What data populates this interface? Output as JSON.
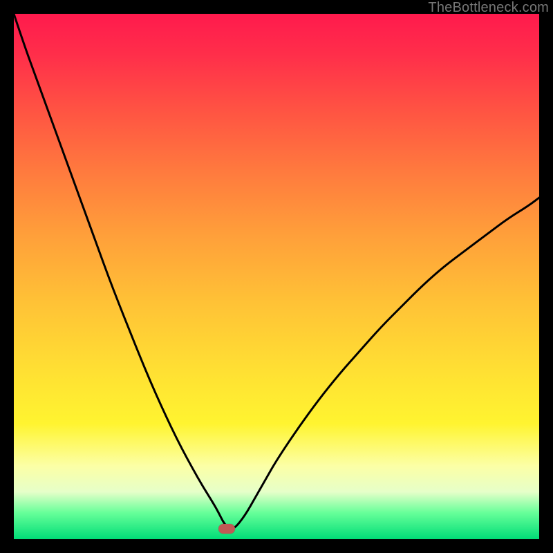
{
  "attribution": "TheBottleneck.com",
  "colors": {
    "frame_border": "#000000",
    "curve_stroke": "#000000",
    "marker_fill": "#c05a55"
  },
  "chart_data": {
    "type": "line",
    "title": "",
    "xlabel": "",
    "ylabel": "",
    "xlim": [
      0,
      100
    ],
    "ylim": [
      0,
      100
    ],
    "annotations": [
      {
        "name": "minimum-marker",
        "x": 40.5,
        "y": 2.0
      }
    ],
    "series": [
      {
        "name": "bottleneck-curve",
        "x": [
          0,
          2,
          4,
          6,
          8,
          10,
          12,
          14,
          16,
          18,
          20,
          22,
          24,
          26,
          28,
          30,
          32,
          34,
          36,
          38,
          39,
          40,
          41,
          42,
          44,
          46,
          48,
          50,
          54,
          58,
          62,
          66,
          70,
          74,
          78,
          82,
          86,
          90,
          94,
          98,
          100
        ],
        "y": [
          100,
          94,
          88.5,
          83,
          77.5,
          72,
          66.5,
          61,
          55.5,
          50,
          44.8,
          39.8,
          34.8,
          30,
          25.5,
          21.2,
          17.2,
          13.5,
          10,
          6.8,
          5,
          3,
          2,
          2,
          4.5,
          8,
          11.5,
          15,
          21,
          26.5,
          31.5,
          36,
          40.5,
          44.5,
          48.5,
          52,
          55,
          58,
          61,
          63.5,
          65
        ]
      }
    ]
  }
}
